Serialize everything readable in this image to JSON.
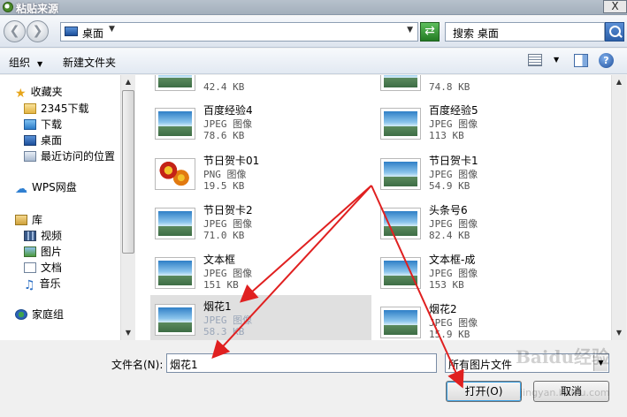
{
  "window": {
    "title": "粘贴来源",
    "close_label": "X"
  },
  "nav": {
    "address": "桌面",
    "search_placeholder": "搜索 桌面"
  },
  "toolbar": {
    "organize": "组织",
    "new_folder": "新建文件夹"
  },
  "sidebar": {
    "favorites": "收藏夹",
    "items": [
      "2345下载",
      "下载",
      "桌面",
      "最近访问的位置"
    ],
    "wps": "WPS网盘",
    "library": "库",
    "library_items": [
      "视频",
      "图片",
      "文档",
      "音乐"
    ],
    "homegroup": "家庭组"
  },
  "files": [
    {
      "name": "",
      "type": "",
      "size": "42.4 KB",
      "icon": "jpeg-thumb"
    },
    {
      "name": "",
      "type": "",
      "size": "74.8 KB",
      "icon": "jpeg-thumb"
    },
    {
      "name": "百度经验4",
      "type": "JPEG 图像",
      "size": "78.6 KB",
      "icon": "jpeg-thumb"
    },
    {
      "name": "百度经验5",
      "type": "JPEG 图像",
      "size": "113 KB",
      "icon": "jpeg-thumb"
    },
    {
      "name": "节日贺卡01",
      "type": "PNG 图像",
      "size": "19.5 KB",
      "icon": "png-thumb"
    },
    {
      "name": "节日贺卡1",
      "type": "JPEG 图像",
      "size": "54.9 KB",
      "icon": "jpeg-thumb"
    },
    {
      "name": "节日贺卡2",
      "type": "JPEG 图像",
      "size": "71.0 KB",
      "icon": "jpeg-thumb"
    },
    {
      "name": "头条号6",
      "type": "JPEG 图像",
      "size": "82.4 KB",
      "icon": "jpeg-thumb"
    },
    {
      "name": "文本框",
      "type": "JPEG 图像",
      "size": "151 KB",
      "icon": "jpeg-thumb"
    },
    {
      "name": "文本框-成",
      "type": "JPEG 图像",
      "size": "153 KB",
      "icon": "jpeg-thumb"
    },
    {
      "name": "烟花1",
      "type": "JPEG 图像",
      "size": "58.3 KB",
      "icon": "jpeg-thumb"
    },
    {
      "name": "烟花2",
      "type": "JPEG 图像",
      "size": "15.9 KB",
      "icon": "jpeg-thumb"
    }
  ],
  "bottom": {
    "filename_label": "文件名(N):",
    "filename_value": "烟花1",
    "filter": "所有图片文件",
    "open": "打开(O)",
    "cancel": "取消"
  },
  "watermark": {
    "logo": "Baidu经验",
    "url": "jingyan.baidu.com"
  },
  "colors": {
    "annotation": "#e02020",
    "selection": "#e0e0e0"
  }
}
